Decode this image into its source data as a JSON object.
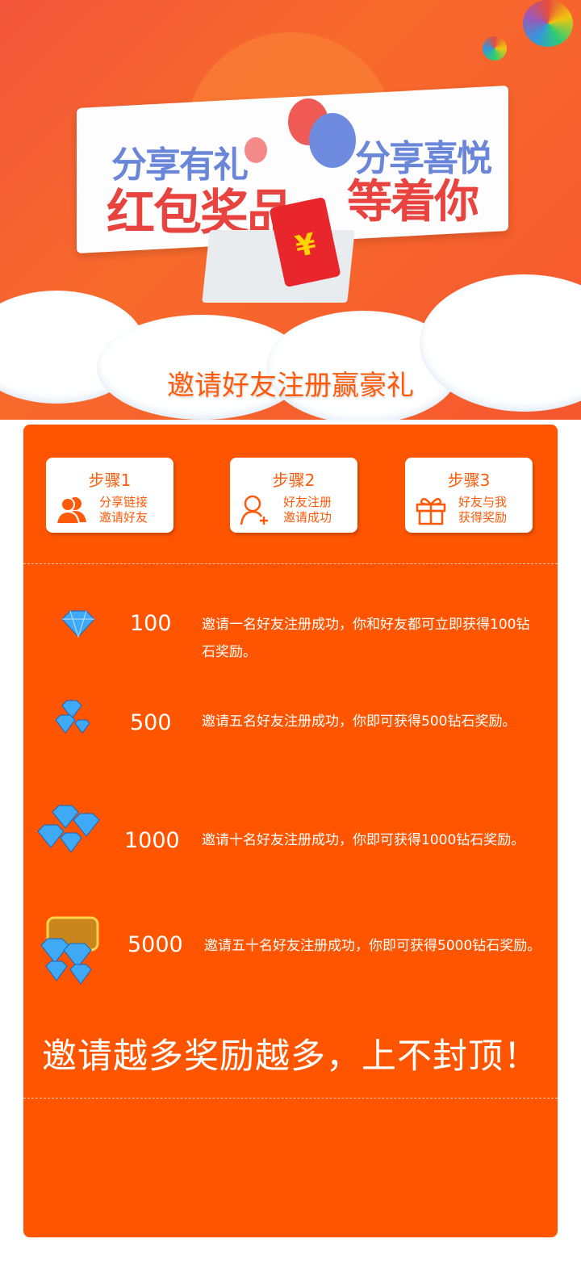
{
  "banner": {
    "line1": "分享有礼",
    "line2": "红包奖品",
    "line3": "分享喜悦",
    "line4": "等着你",
    "envelope_symbol": "¥"
  },
  "title": "邀请好友注册赢豪礼",
  "steps": [
    {
      "label": "步骤1",
      "line1": "分享链接",
      "line2": "邀请好友",
      "icon": "users-icon"
    },
    {
      "label": "步骤2",
      "line1": "好友注册",
      "line2": "邀请成功",
      "icon": "user-add-icon"
    },
    {
      "label": "步骤3",
      "line1": "好友与我",
      "line2": "获得奖励",
      "icon": "gift-icon"
    }
  ],
  "rewards": [
    {
      "amount": "100",
      "desc": "邀请一名好友注册成功，你和好友都可立即获得100钻石奖励。"
    },
    {
      "amount": "500",
      "desc": "邀请五名好友注册成功，你即可获得500钻石奖励。"
    },
    {
      "amount": "1000",
      "desc": "邀请十名好友注册成功，你即可获得1000钻石奖励。"
    },
    {
      "amount": "5000",
      "desc": "邀请五十名好友注册成功，你即可获得5000钻石奖励。"
    }
  ],
  "slogan": "邀请越多奖励越多，上不封顶！",
  "colors": {
    "accent": "#ff5500",
    "banner_blue": "#6a86d8",
    "banner_red": "#e8433f"
  }
}
